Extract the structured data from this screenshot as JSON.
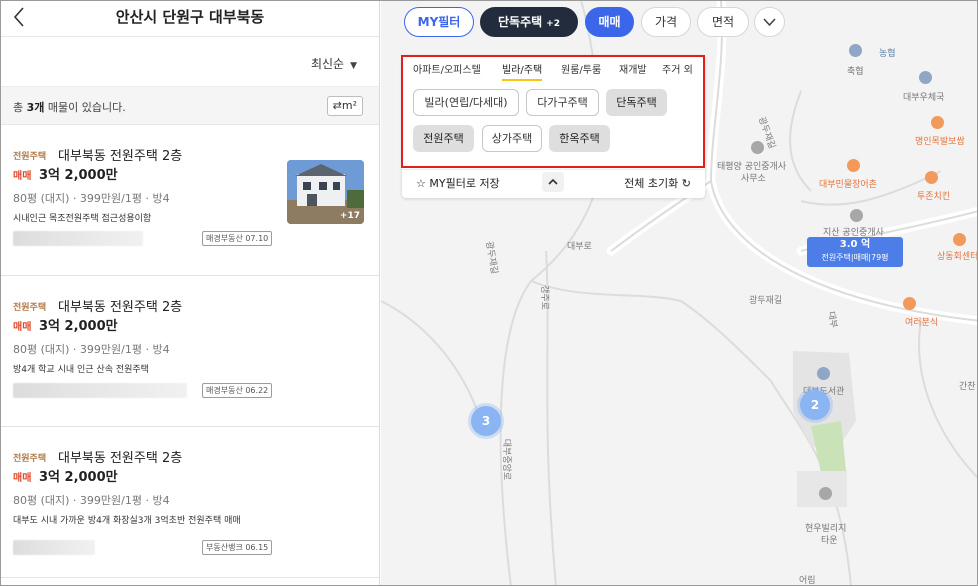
{
  "header": {
    "title": "안산시 단원구 대부북동"
  },
  "sort": {
    "label": "최신순"
  },
  "summary": {
    "prefix": "총 ",
    "count": "3개",
    "suffix": " 매물이 있습니다.",
    "unit_toggle": "m²"
  },
  "listings": [
    {
      "type": "전원주택",
      "name": "대부북동 전원주택 2층",
      "deal": "매매",
      "price": "3억 2,000만",
      "spec": "80평 (대지) · 399만원/1평 · 방4",
      "desc": "시내인근 목조전원주택 접근성용이함",
      "agent": "매경부동산 07.10",
      "photo_count": "+17"
    },
    {
      "type": "전원주택",
      "name": "대부북동 전원주택 2층",
      "deal": "매매",
      "price": "3억 2,000만",
      "spec": "80평 (대지) · 399만원/1평 · 방4",
      "desc": "방4개 학교 시내 인근 산속 전원주택",
      "agent": "매경부동산 06.22"
    },
    {
      "type": "전원주택",
      "name": "대부북동 전원주택 2층",
      "deal": "매매",
      "price": "3억 2,000만",
      "spec": "80평 (대지) · 399만원/1평 · 방4",
      "desc": "대부도 시내 가까운 방4개 화장실3개 3억초반 전원주택 매매",
      "agent": "부동산뱅크 06.15"
    }
  ],
  "chips": {
    "my_filter": "MY필터",
    "property_type": "단독주택",
    "property_type_extra": "+2",
    "deal": "매매",
    "price": "가격",
    "area": "면적"
  },
  "filter_panel": {
    "tabs": [
      "아파트/오피스텔",
      "빌라/주택",
      "원룸/투룸",
      "재개발",
      "주거 외"
    ],
    "active_tab": "빌라/주택",
    "options": [
      {
        "label": "빌라(연립/다세대)",
        "selected": false
      },
      {
        "label": "다가구주택",
        "selected": false
      },
      {
        "label": "단독주택",
        "selected": true
      },
      {
        "label": "전원주택",
        "selected": true
      },
      {
        "label": "상가주택",
        "selected": false
      },
      {
        "label": "한옥주택",
        "selected": true
      }
    ],
    "save_label": "MY필터로 저장",
    "reset_label": "전체 초기화"
  },
  "map": {
    "labels": {
      "nh": "농협",
      "chukhyeop": "축협",
      "daebu_office": "대부우체국",
      "pharmacy": "명인목발보쌈",
      "tpy": "태평양 공인중개사",
      "tpy2": "사무소",
      "jangeo": "대부민물장어촌",
      "tuen": "투존치킨",
      "jisan": "지산 공인중개사",
      "sangdong": "상동회센터",
      "yeoreo": "여러분식",
      "library": "대부도서관",
      "hyunwoo1": "현우빌리지",
      "hyunwoo2": "타운",
      "gangan": "간찬",
      "road1": "광두재길",
      "road2": "광두재길",
      "road3": "대부",
      "road4": "대부로",
      "road5": "광두재길",
      "road6": "갱주로",
      "road7": "대부중앙로",
      "road8": "어림"
    },
    "clusters": [
      "3",
      "2"
    ],
    "price_marker": {
      "value": "3.0 억",
      "label": "전원주택|매매|79평"
    },
    "colors": {
      "accent": "#3c66ea",
      "dark": "#232c3d",
      "highlight": "#e01e1e",
      "cluster": "#8ab4f2"
    }
  }
}
